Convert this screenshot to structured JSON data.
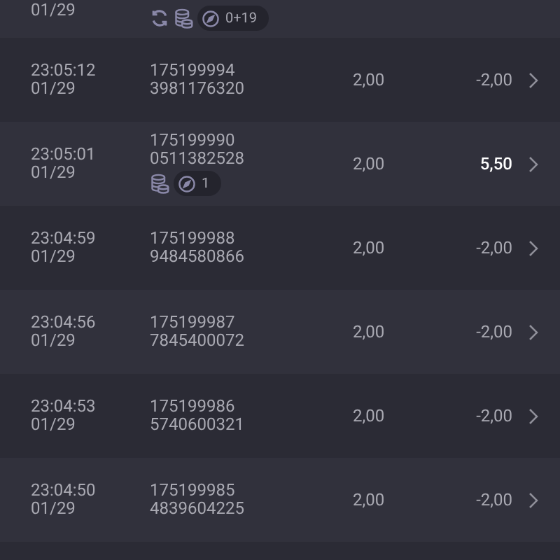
{
  "partial_row": {
    "date": "01/29",
    "badges": [
      {
        "kind": "cycle"
      },
      {
        "kind": "coins"
      },
      {
        "kind": "counter",
        "text": "0+19"
      }
    ]
  },
  "rows": [
    {
      "time": "23:05:12",
      "date": "01/29",
      "id": "175199994",
      "code": "3981176320",
      "stake": "2,00",
      "result": "-2,00",
      "highlighted": false,
      "badges": []
    },
    {
      "time": "23:05:01",
      "date": "01/29",
      "id": "175199990",
      "code": "0511382528",
      "stake": "2,00",
      "result": "5,50",
      "highlighted": true,
      "badges": [
        {
          "kind": "coins"
        },
        {
          "kind": "counter",
          "text": "1"
        }
      ]
    },
    {
      "time": "23:04:59",
      "date": "01/29",
      "id": "175199988",
      "code": "9484580866",
      "stake": "2,00",
      "result": "-2,00",
      "highlighted": false,
      "badges": []
    },
    {
      "time": "23:04:56",
      "date": "01/29",
      "id": "175199987",
      "code": "7845400072",
      "stake": "2,00",
      "result": "-2,00",
      "highlighted": false,
      "badges": []
    },
    {
      "time": "23:04:53",
      "date": "01/29",
      "id": "175199986",
      "code": "5740600321",
      "stake": "2,00",
      "result": "-2,00",
      "highlighted": false,
      "badges": []
    },
    {
      "time": "23:04:50",
      "date": "01/29",
      "id": "175199985",
      "code": "4839604225",
      "stake": "2,00",
      "result": "-2,00",
      "highlighted": false,
      "badges": []
    }
  ]
}
